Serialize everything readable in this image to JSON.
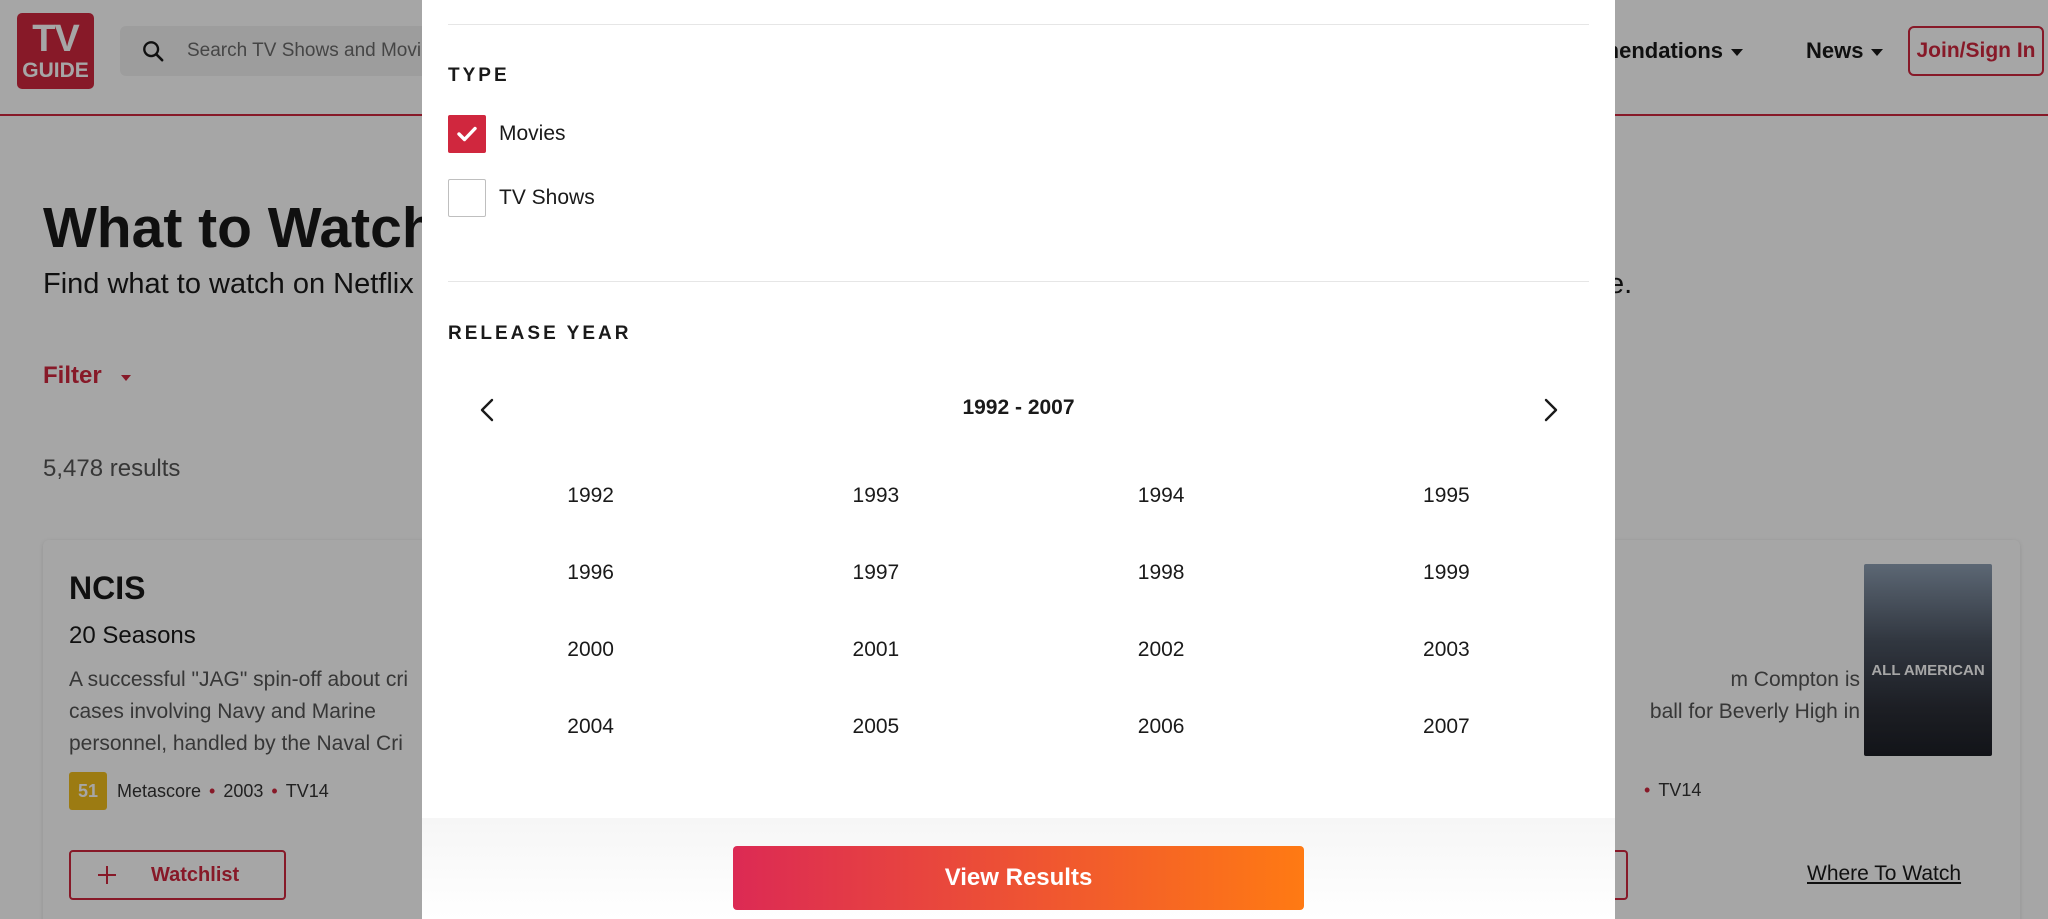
{
  "header": {
    "logo_line1": "TV",
    "logo_line2": "GUIDE",
    "search_placeholder": "Search TV Shows and Movi",
    "nav_recommendations": "mmendations",
    "nav_news": "News",
    "join_label": "Join/Sign In"
  },
  "page": {
    "title": "What to Watch",
    "subtitle": "Find what to watch on Netflix",
    "subtitle_end": "e.",
    "filter_label": "Filter",
    "results_count": "5,478 results"
  },
  "cards": {
    "left": {
      "title": "NCIS",
      "seasons": "20 Seasons",
      "desc_lines": [
        "A successful \"JAG\" spin-off about cri",
        "cases involving Navy and Marine",
        "personnel, handled by the Naval Cri"
      ],
      "metascore": "51",
      "metascore_label": "Metascore",
      "year": "2003",
      "rating": "TV14",
      "watchlist_label": "Watchlist"
    },
    "right": {
      "desc_lines": [
        "m Compton is",
        "ball for Beverly High in"
      ],
      "rating": "TV14",
      "poster_text": "ALL AMERICAN",
      "where_label": "Where To Watch"
    }
  },
  "modal": {
    "type_heading": "TYPE",
    "type_options": [
      {
        "label": "Movies",
        "checked": true
      },
      {
        "label": "TV Shows",
        "checked": false
      }
    ],
    "release_heading": "RELEASE YEAR",
    "year_range": "1992 - 2007",
    "years": [
      "1992",
      "1993",
      "1994",
      "1995",
      "1996",
      "1997",
      "1998",
      "1999",
      "2000",
      "2001",
      "2002",
      "2003",
      "2004",
      "2005",
      "2006",
      "2007"
    ],
    "view_results_label": "View Results"
  },
  "colors": {
    "brand_red": "#d0273e",
    "gradient_start": "#dc2a54",
    "gradient_end": "#ff7a13",
    "metascore_yellow": "#f0bd1c"
  },
  "icons": {
    "search": "search-icon",
    "check": "check-icon",
    "prev": "chevron-left-icon",
    "next": "chevron-right-icon",
    "plus": "plus-icon"
  }
}
